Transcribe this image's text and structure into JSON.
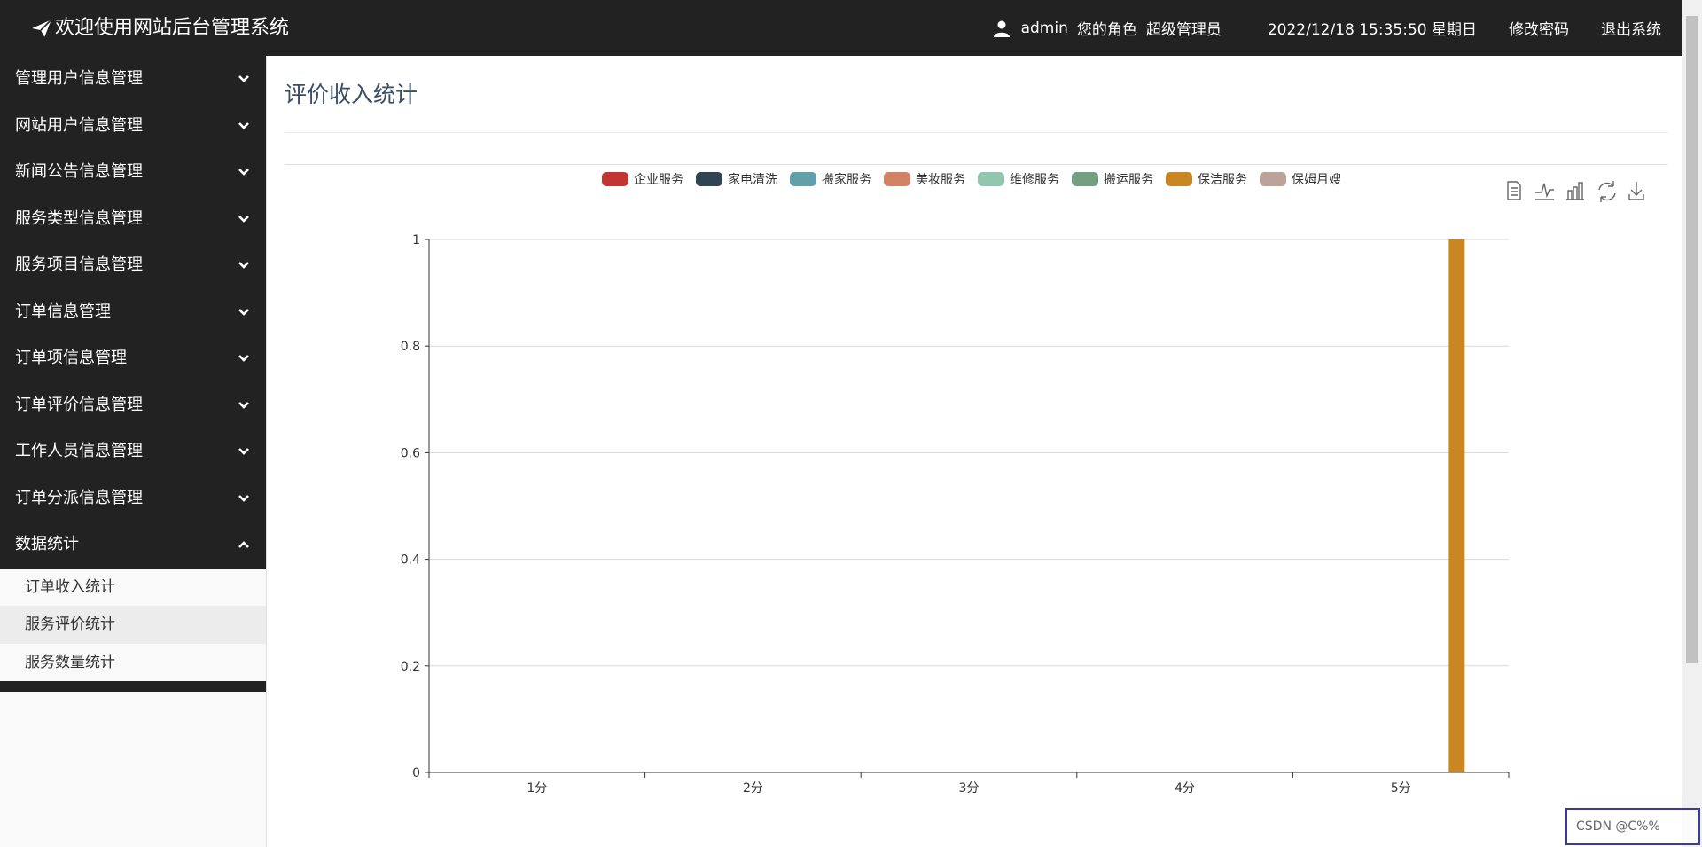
{
  "header": {
    "title": "欢迎使用网站后台管理系统",
    "username": "admin",
    "role_label": "您的角色",
    "role": "超级管理员",
    "datetime": "2022/12/18 15:35:50 星期日",
    "change_password": "修改密码",
    "logout": "退出系统"
  },
  "sidebar": {
    "items": [
      {
        "label": "管理用户信息管理",
        "icon": "chevron-down-icon"
      },
      {
        "label": "网站用户信息管理",
        "icon": "chevron-down-icon"
      },
      {
        "label": "新闻公告信息管理",
        "icon": "chevron-down-icon"
      },
      {
        "label": "服务类型信息管理",
        "icon": "chevron-down-icon"
      },
      {
        "label": "服务项目信息管理",
        "icon": "chevron-down-icon"
      },
      {
        "label": "订单信息管理",
        "icon": "chevron-down-icon"
      },
      {
        "label": "订单项信息管理",
        "icon": "chevron-down-icon"
      },
      {
        "label": "订单评价信息管理",
        "icon": "chevron-down-icon"
      },
      {
        "label": "工作人员信息管理",
        "icon": "chevron-down-icon"
      },
      {
        "label": "订单分派信息管理",
        "icon": "chevron-down-icon"
      },
      {
        "label": "数据统计",
        "icon": "chevron-up-icon"
      }
    ],
    "subitems": [
      {
        "label": "订单收入统计"
      },
      {
        "label": "服务评价统计"
      },
      {
        "label": "服务数量统计"
      }
    ]
  },
  "main": {
    "page_title": "评价收入统计"
  },
  "toolbox": [
    "data-view-icon",
    "line-chart-icon",
    "bar-chart-icon",
    "restore-icon",
    "download-icon"
  ],
  "watermark": "CSDN @C%%",
  "chart_data": {
    "type": "bar",
    "categories": [
      "1分",
      "2分",
      "3分",
      "4分",
      "5分"
    ],
    "series": [
      {
        "name": "企业服务",
        "color": "#c23531",
        "values": [
          0,
          0,
          0,
          0,
          0
        ]
      },
      {
        "name": "家电清洗",
        "color": "#2f4554",
        "values": [
          0,
          0,
          0,
          0,
          0
        ]
      },
      {
        "name": "搬家服务",
        "color": "#61a0a8",
        "values": [
          0,
          0,
          0,
          0,
          0
        ]
      },
      {
        "name": "美妆服务",
        "color": "#d48265",
        "values": [
          0,
          0,
          0,
          0,
          0
        ]
      },
      {
        "name": "维修服务",
        "color": "#91c7ae",
        "values": [
          0,
          0,
          0,
          0,
          0
        ]
      },
      {
        "name": "搬运服务",
        "color": "#749f83",
        "values": [
          0,
          0,
          0,
          0,
          0
        ]
      },
      {
        "name": "保洁服务",
        "color": "#ca8622",
        "values": [
          0,
          0,
          0,
          0,
          1
        ]
      },
      {
        "name": "保姆月嫂",
        "color": "#bda29a",
        "values": [
          0,
          0,
          0,
          0,
          0
        ]
      }
    ],
    "ylim": [
      0,
      1
    ],
    "yticks": [
      "0",
      "0.2",
      "0.4",
      "0.6",
      "0.8",
      "1"
    ],
    "grid": true,
    "legend": "top-center"
  }
}
